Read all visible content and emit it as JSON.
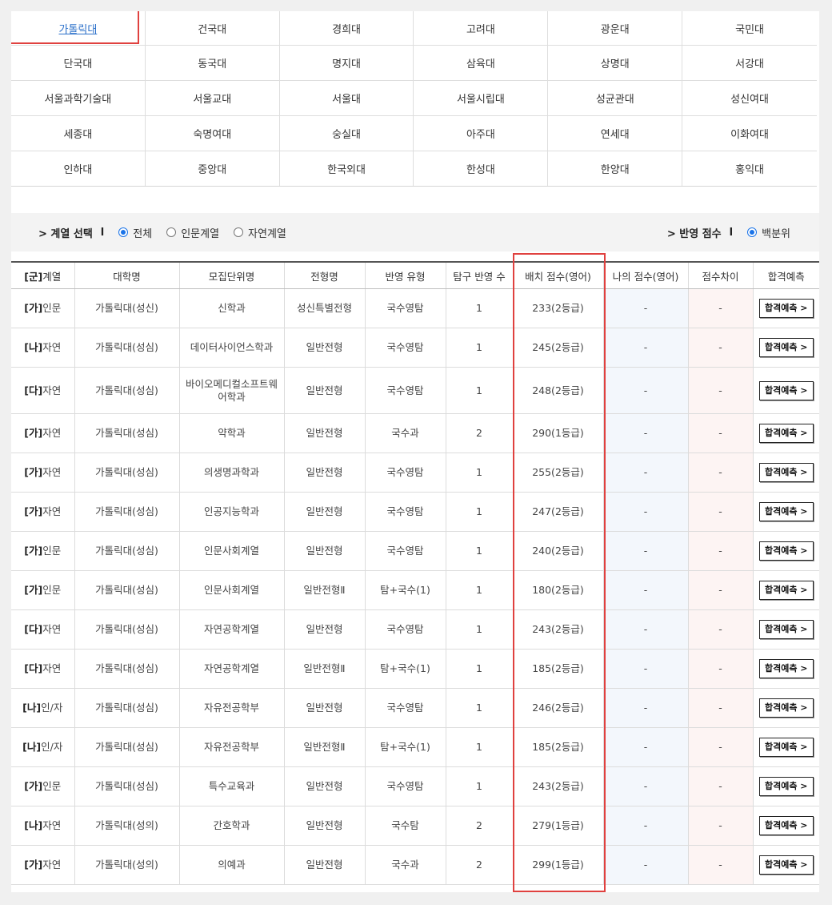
{
  "universities": [
    "가톨릭대",
    "건국대",
    "경희대",
    "고려대",
    "광운대",
    "국민대",
    "단국대",
    "동국대",
    "명지대",
    "삼육대",
    "상명대",
    "서강대",
    "서울과학기술대",
    "서울교대",
    "서울대",
    "서울시립대",
    "성균관대",
    "성신여대",
    "세종대",
    "숙명여대",
    "숭실대",
    "아주대",
    "연세대",
    "이화여대",
    "인하대",
    "중앙대",
    "한국외대",
    "한성대",
    "한양대",
    "홍익대"
  ],
  "selected_university": "가톨릭대",
  "filter": {
    "category_label": "> 계열 선택",
    "category_sep": "l",
    "category_options": [
      "전체",
      "인문계열",
      "자연계열"
    ],
    "category_selected": "전체",
    "score_label": "> 반영 점수",
    "score_sep": "l",
    "score_options": [
      "백분위"
    ],
    "score_selected": "백분위"
  },
  "table": {
    "headers": {
      "group": "[군]",
      "group_suffix": "계열",
      "university": "대학명",
      "unit": "모집단위명",
      "admission": "전형명",
      "type": "반영 유형",
      "inquiry": "탐구 반영 수",
      "placement": "배치 점수(영어)",
      "my_score": "나의 점수(영어)",
      "diff": "점수차이",
      "predict": "합격예측"
    },
    "rows": [
      {
        "grp": "[가]",
        "field": "인문",
        "univ": "가톨릭대(성신)",
        "unit": "신학과",
        "admission": "성신특별전형",
        "type": "국수영탐",
        "inquiry": "1",
        "placement": "233(2등급)",
        "my": "-",
        "diff": "-",
        "btn": "합격예측 >"
      },
      {
        "grp": "[나]",
        "field": "자연",
        "univ": "가톨릭대(성심)",
        "unit": "데이터사이언스학과",
        "admission": "일반전형",
        "type": "국수영탐",
        "inquiry": "1",
        "placement": "245(2등급)",
        "my": "-",
        "diff": "-",
        "btn": "합격예측 >"
      },
      {
        "grp": "[다]",
        "field": "자연",
        "univ": "가톨릭대(성심)",
        "unit": "바이오메디컬소프트웨어학과",
        "admission": "일반전형",
        "type": "국수영탐",
        "inquiry": "1",
        "placement": "248(2등급)",
        "my": "-",
        "diff": "-",
        "btn": "합격예측 >"
      },
      {
        "grp": "[가]",
        "field": "자연",
        "univ": "가톨릭대(성심)",
        "unit": "약학과",
        "admission": "일반전형",
        "type": "국수과",
        "inquiry": "2",
        "placement": "290(1등급)",
        "my": "-",
        "diff": "-",
        "btn": "합격예측 >"
      },
      {
        "grp": "[가]",
        "field": "자연",
        "univ": "가톨릭대(성심)",
        "unit": "의생명과학과",
        "admission": "일반전형",
        "type": "국수영탐",
        "inquiry": "1",
        "placement": "255(2등급)",
        "my": "-",
        "diff": "-",
        "btn": "합격예측 >"
      },
      {
        "grp": "[가]",
        "field": "자연",
        "univ": "가톨릭대(성심)",
        "unit": "인공지능학과",
        "admission": "일반전형",
        "type": "국수영탐",
        "inquiry": "1",
        "placement": "247(2등급)",
        "my": "-",
        "diff": "-",
        "btn": "합격예측 >"
      },
      {
        "grp": "[가]",
        "field": "인문",
        "univ": "가톨릭대(성심)",
        "unit": "인문사회계열",
        "admission": "일반전형",
        "type": "국수영탐",
        "inquiry": "1",
        "placement": "240(2등급)",
        "my": "-",
        "diff": "-",
        "btn": "합격예측 >"
      },
      {
        "grp": "[가]",
        "field": "인문",
        "univ": "가톨릭대(성심)",
        "unit": "인문사회계열",
        "admission": "일반전형Ⅱ",
        "type": "탐+국수(1)",
        "inquiry": "1",
        "placement": "180(2등급)",
        "my": "-",
        "diff": "-",
        "btn": "합격예측 >"
      },
      {
        "grp": "[다]",
        "field": "자연",
        "univ": "가톨릭대(성심)",
        "unit": "자연공학계열",
        "admission": "일반전형",
        "type": "국수영탐",
        "inquiry": "1",
        "placement": "243(2등급)",
        "my": "-",
        "diff": "-",
        "btn": "합격예측 >"
      },
      {
        "grp": "[다]",
        "field": "자연",
        "univ": "가톨릭대(성심)",
        "unit": "자연공학계열",
        "admission": "일반전형Ⅱ",
        "type": "탐+국수(1)",
        "inquiry": "1",
        "placement": "185(2등급)",
        "my": "-",
        "diff": "-",
        "btn": "합격예측 >"
      },
      {
        "grp": "[나]",
        "field": "인/자",
        "univ": "가톨릭대(성심)",
        "unit": "자유전공학부",
        "admission": "일반전형",
        "type": "국수영탐",
        "inquiry": "1",
        "placement": "246(2등급)",
        "my": "-",
        "diff": "-",
        "btn": "합격예측 >"
      },
      {
        "grp": "[나]",
        "field": "인/자",
        "univ": "가톨릭대(성심)",
        "unit": "자유전공학부",
        "admission": "일반전형Ⅱ",
        "type": "탐+국수(1)",
        "inquiry": "1",
        "placement": "185(2등급)",
        "my": "-",
        "diff": "-",
        "btn": "합격예측 >"
      },
      {
        "grp": "[가]",
        "field": "인문",
        "univ": "가톨릭대(성심)",
        "unit": "특수교육과",
        "admission": "일반전형",
        "type": "국수영탐",
        "inquiry": "1",
        "placement": "243(2등급)",
        "my": "-",
        "diff": "-",
        "btn": "합격예측 >"
      },
      {
        "grp": "[나]",
        "field": "자연",
        "univ": "가톨릭대(성의)",
        "unit": "간호학과",
        "admission": "일반전형",
        "type": "국수탐",
        "inquiry": "2",
        "placement": "279(1등급)",
        "my": "-",
        "diff": "-",
        "btn": "합격예측 >"
      },
      {
        "grp": "[가]",
        "field": "자연",
        "univ": "가톨릭대(성의)",
        "unit": "의예과",
        "admission": "일반전형",
        "type": "국수과",
        "inquiry": "2",
        "placement": "299(1등급)",
        "my": "-",
        "diff": "-",
        "btn": "합격예측 >"
      }
    ]
  }
}
